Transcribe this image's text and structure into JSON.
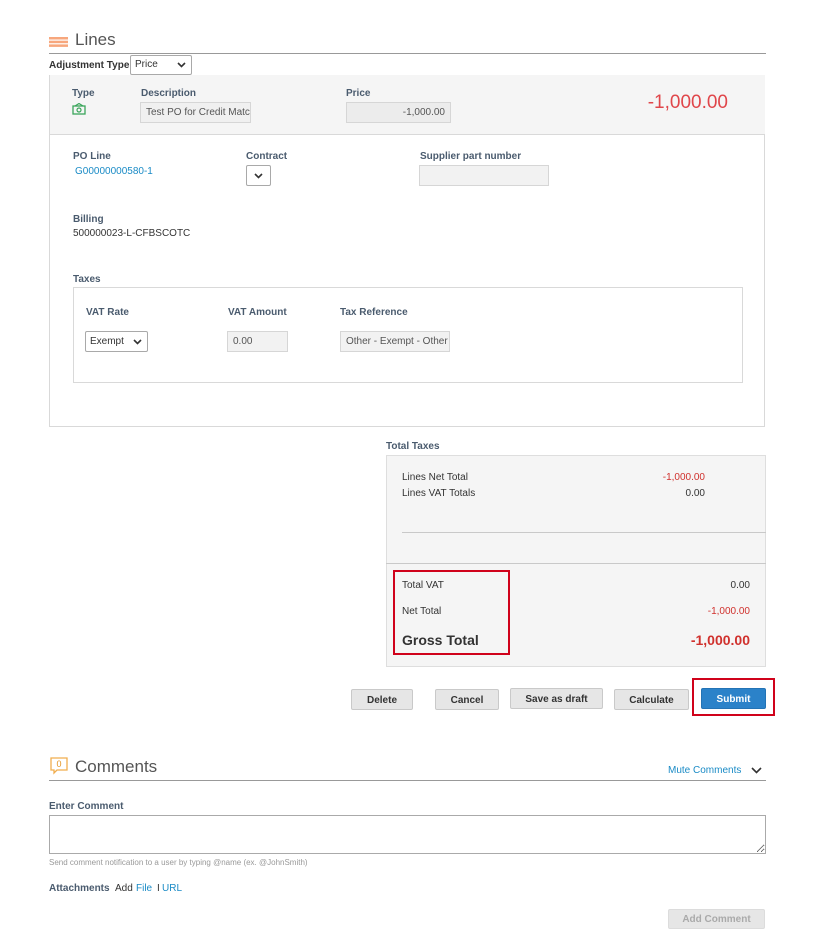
{
  "lines": {
    "title": "Lines",
    "adjustment_type_label": "Adjustment Type",
    "adjustment_type_value": "Price",
    "header_row": {
      "type_label": "Type",
      "description_label": "Description",
      "description_value": "Test PO for Credit Matc",
      "price_label": "Price",
      "price_value": "-1,000.00",
      "line_total": "-1,000.00"
    },
    "details": {
      "po_line_label": "PO Line",
      "po_line_value": "G00000000580-1",
      "contract_label": "Contract",
      "supplier_part_label": "Supplier part number",
      "billing_label": "Billing",
      "billing_value": "500000023-L-CFBSCOTC",
      "taxes_label": "Taxes",
      "vat_rate_label": "VAT Rate",
      "vat_rate_value": "Exempt",
      "vat_amount_label": "VAT Amount",
      "vat_amount_value": "0.00",
      "tax_reference_label": "Tax Reference",
      "tax_reference_value": "Other - Exempt - Other"
    }
  },
  "totals": {
    "title": "Total Taxes",
    "lines_net_total_label": "Lines Net Total",
    "lines_net_total_value": "-1,000.00",
    "lines_vat_totals_label": "Lines VAT Totals",
    "lines_vat_totals_value": "0.00",
    "total_vat_label": "Total VAT",
    "total_vat_value": "0.00",
    "net_total_label": "Net Total",
    "net_total_value": "-1,000.00",
    "gross_total_label": "Gross Total",
    "gross_total_value": "-1,000.00"
  },
  "actions": {
    "delete": "Delete",
    "cancel": "Cancel",
    "save_draft": "Save as draft",
    "calculate": "Calculate",
    "submit": "Submit"
  },
  "comments": {
    "count": "0",
    "title": "Comments",
    "mute": "Mute Comments",
    "enter_label": "Enter Comment",
    "hint": "Send comment notification to a user by typing @name (ex. @JohnSmith)",
    "attachments_label": "Attachments",
    "add_label": "Add",
    "file_link": "File",
    "separator": "I",
    "url_link": "URL",
    "add_comment": "Add Comment"
  },
  "colors": {
    "accent_blue": "#1a8bc6",
    "negative_red": "#d0312d",
    "highlight_box_red": "#d0021b",
    "submit_blue": "#2b82c9"
  }
}
